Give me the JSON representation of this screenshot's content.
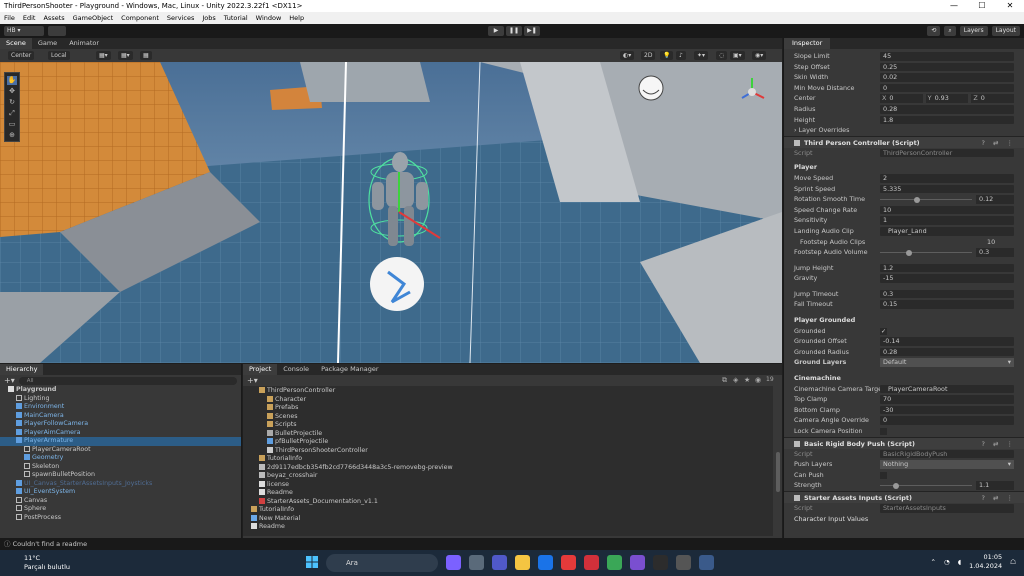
{
  "window": {
    "title": "ThirdPersonShooter - Playground - Windows, Mac, Linux - Unity 2022.3.22f1 <DX11>",
    "controls": [
      "—",
      "☐",
      "✕"
    ]
  },
  "menu": [
    "File",
    "Edit",
    "Assets",
    "GameObject",
    "Component",
    "Services",
    "Jobs",
    "Tutorial",
    "Window",
    "Help"
  ],
  "toolbar": {
    "account": "HB ▾",
    "play": "▶",
    "pause": "❚❚",
    "step": "▶❚",
    "layers": "Layers",
    "layout": "Layout"
  },
  "scene": {
    "tabs": [
      "Scene",
      "Game",
      "Animator"
    ],
    "pivot": "Center",
    "space": "Local",
    "mode_2d": "2D"
  },
  "hierarchy": {
    "tab": "Hierarchy",
    "search_placeholder": "All",
    "items": [
      {
        "label": "Playground",
        "indent": 1,
        "type": "scene"
      },
      {
        "label": "Lighting",
        "indent": 2,
        "type": "obj"
      },
      {
        "label": "Environment",
        "indent": 2,
        "type": "prefab"
      },
      {
        "label": "MainCamera",
        "indent": 2,
        "type": "prefab"
      },
      {
        "label": "PlayerFollowCamera",
        "indent": 2,
        "type": "prefab"
      },
      {
        "label": "PlayerAimCamera",
        "indent": 2,
        "type": "prefab"
      },
      {
        "label": "PlayerArmature",
        "indent": 2,
        "type": "prefab",
        "selected": true
      },
      {
        "label": "PlayerCameraRoot",
        "indent": 3,
        "type": "obj"
      },
      {
        "label": "Geometry",
        "indent": 3,
        "type": "prefab"
      },
      {
        "label": "Skeleton",
        "indent": 3,
        "type": "obj"
      },
      {
        "label": "spawnBulletPosition",
        "indent": 3,
        "type": "obj"
      },
      {
        "label": "UI_Canvas_StarterAssetsInputs_Joysticks",
        "indent": 2,
        "type": "prefab-dim"
      },
      {
        "label": "UI_EventSystem",
        "indent": 2,
        "type": "prefab"
      },
      {
        "label": "Canvas",
        "indent": 2,
        "type": "obj"
      },
      {
        "label": "Sphere",
        "indent": 2,
        "type": "obj"
      },
      {
        "label": "PostProcess",
        "indent": 2,
        "type": "obj"
      }
    ]
  },
  "project": {
    "tabs": [
      "Project",
      "Console",
      "Package Manager"
    ],
    "count": "19",
    "items": [
      {
        "label": "ThirdPersonController",
        "indent": 2,
        "type": "folder"
      },
      {
        "label": "Character",
        "indent": 3,
        "type": "folder"
      },
      {
        "label": "Prefabs",
        "indent": 3,
        "type": "folder"
      },
      {
        "label": "Scenes",
        "indent": 3,
        "type": "folder"
      },
      {
        "label": "Scripts",
        "indent": 3,
        "type": "folder"
      },
      {
        "label": "BulletProjectile",
        "indent": 3,
        "type": "asset"
      },
      {
        "label": "pfBulletProjectile",
        "indent": 3,
        "type": "prefab"
      },
      {
        "label": "ThirdPersonShooterController",
        "indent": 3,
        "type": "script"
      },
      {
        "label": "TutorialInfo",
        "indent": 2,
        "type": "folder"
      },
      {
        "label": "2d9117edbcb354fb2cd7766d3448a3c5-removebg-preview",
        "indent": 2,
        "type": "image"
      },
      {
        "label": "beyaz_crosshair",
        "indent": 2,
        "type": "image"
      },
      {
        "label": "license",
        "indent": 2,
        "type": "file"
      },
      {
        "label": "Readme",
        "indent": 2,
        "type": "file"
      },
      {
        "label": "StarterAssets_Documentation_v1.1",
        "indent": 2,
        "type": "pdf"
      },
      {
        "label": "TutorialInfo",
        "indent": 1,
        "type": "folder"
      },
      {
        "label": "New Material",
        "indent": 1,
        "type": "material"
      },
      {
        "label": "Readme",
        "indent": 1,
        "type": "file"
      }
    ]
  },
  "inspector": {
    "tab": "Inspector",
    "cc_rows": [
      {
        "label": "Slope Limit",
        "value": "45"
      },
      {
        "label": "Step Offset",
        "value": "0.25"
      },
      {
        "label": "Skin Width",
        "value": "0.02"
      },
      {
        "label": "Min Move Distance",
        "value": "0"
      }
    ],
    "center": {
      "label": "Center",
      "x": "0",
      "y": "0.93",
      "z": "0"
    },
    "cc_rows2": [
      {
        "label": "Radius",
        "value": "0.28"
      },
      {
        "label": "Height",
        "value": "1.8"
      }
    ],
    "layer_overrides": "Layer Overrides",
    "tpc": {
      "title": "Third Person Controller (Script)",
      "script_label": "Script",
      "script_value": "ThirdPersonController",
      "player_header": "Player",
      "move_speed": {
        "label": "Move Speed",
        "value": "2"
      },
      "sprint_speed": {
        "label": "Sprint Speed",
        "value": "5.335"
      },
      "rotation_smooth": {
        "label": "Rotation Smooth Time",
        "value": "0.12",
        "fill": 0.4
      },
      "speed_change": {
        "label": "Speed Change Rate",
        "value": "10"
      },
      "sensitivity": {
        "label": "Sensitivity",
        "value": "1"
      },
      "landing_clip": {
        "label": "Landing Audio Clip",
        "value": "Player_Land"
      },
      "footstep_clips": {
        "label": "Footstep Audio Clips",
        "value": "10"
      },
      "footstep_volume": {
        "label": "Footstep Audio Volume",
        "value": "0.3",
        "fill": 0.3
      },
      "jump_height": {
        "label": "Jump Height",
        "value": "1.2"
      },
      "gravity": {
        "label": "Gravity",
        "value": "-15"
      },
      "jump_timeout": {
        "label": "Jump Timeout",
        "value": "0.3"
      },
      "fall_timeout": {
        "label": "Fall Timeout",
        "value": "0.15"
      },
      "grounded_header": "Player Grounded",
      "grounded": {
        "label": "Grounded",
        "value": "✓"
      },
      "grounded_offset": {
        "label": "Grounded Offset",
        "value": "-0.14"
      },
      "grounded_radius": {
        "label": "Grounded Radius",
        "value": "0.28"
      },
      "ground_layers": {
        "label": "Ground Layers",
        "value": "Default"
      },
      "cinemachine_header": "Cinemachine",
      "cam_target": {
        "label": "Cinemachine Camera Target",
        "value": "PlayerCameraRoot"
      },
      "top_clamp": {
        "label": "Top Clamp",
        "value": "70"
      },
      "bottom_clamp": {
        "label": "Bottom Clamp",
        "value": "-30"
      },
      "cam_override": {
        "label": "Camera Angle Override",
        "value": "0"
      },
      "lock_cam": {
        "label": "Lock Camera Position",
        "value": ""
      }
    },
    "brbp": {
      "title": "Basic Rigid Body Push (Script)",
      "script_label": "Script",
      "script_value": "BasicRigidBodyPush",
      "push_layers": {
        "label": "Push Layers",
        "value": "Nothing"
      },
      "can_push": {
        "label": "Can Push",
        "value": ""
      },
      "strength": {
        "label": "Strength",
        "value": "1.1",
        "fill": 0.15
      }
    },
    "sai": {
      "title": "Starter Assets Inputs (Script)",
      "script_label": "Script",
      "script_value": "StarterAssetsInputs",
      "next": "Character Input Values"
    }
  },
  "status": "Couldn't find a readme",
  "taskbar": {
    "temp": "11°C",
    "weather": "Parçalı bulutlu",
    "search": "Ara",
    "time": "01:05",
    "date": "1.04.2024"
  }
}
